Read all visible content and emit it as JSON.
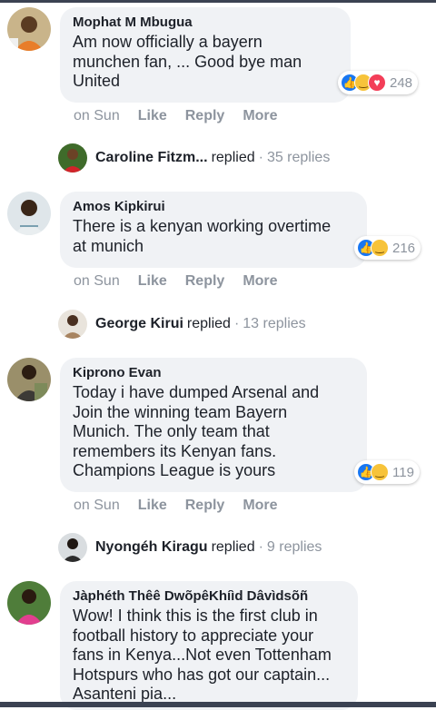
{
  "comments": [
    {
      "author": "Mophat M Mbugua",
      "lines": [
        "Am now officially a bayern",
        "munchen fan, ... Good bye man",
        "United"
      ],
      "reaction_count": "248",
      "reaction_icons": [
        "like-icon",
        "haha-icon",
        "love-icon"
      ],
      "time": "on Sun",
      "like": "Like",
      "reply": "Reply",
      "more": "More",
      "replies": {
        "name": "Caroline Fitzm...",
        "verb": "replied",
        "dot": "·",
        "count": "35 replies"
      }
    },
    {
      "author": "Amos Kipkirui",
      "lines": [
        "There is a kenyan working overtime",
        "at munich"
      ],
      "reaction_count": "216",
      "reaction_icons": [
        "like-icon",
        "haha-icon"
      ],
      "time": "on Sun",
      "like": "Like",
      "reply": "Reply",
      "more": "More",
      "replies": {
        "name": "George Kirui",
        "verb": "replied",
        "dot": "·",
        "count": "13 replies"
      }
    },
    {
      "author": "Kiprono Evan",
      "lines": [
        "Today i have dumped Arsenal and",
        "Join the winning team Bayern",
        "Munich. The only team that",
        "remembers its Kenyan fans.",
        "Champions League is yours"
      ],
      "reaction_count": "119",
      "reaction_icons": [
        "like-icon",
        "haha-icon"
      ],
      "time": "on Sun",
      "like": "Like",
      "reply": "Reply",
      "more": "More",
      "replies": {
        "name": "Nyongéh Kiragu",
        "verb": "replied",
        "dot": "·",
        "count": "9 replies"
      }
    },
    {
      "author": "Jàphéth Thêê DwõpêKhíìd Dâvìdsõñ",
      "lines": [
        "Wow! I think this is the first club in",
        "football history to appreciate your",
        "fans in Kenya...Not even Tottenham",
        "Hotspurs who has got our captain...",
        "Asanteni pia..."
      ]
    }
  ],
  "colors": {
    "bubble": "#f0f2f5",
    "meta": "#8d949e",
    "like_blue": "#1877f2",
    "haha_yellow": "#f7c33a",
    "love_red": "#f33e58",
    "status_bar": "#3b4252"
  }
}
